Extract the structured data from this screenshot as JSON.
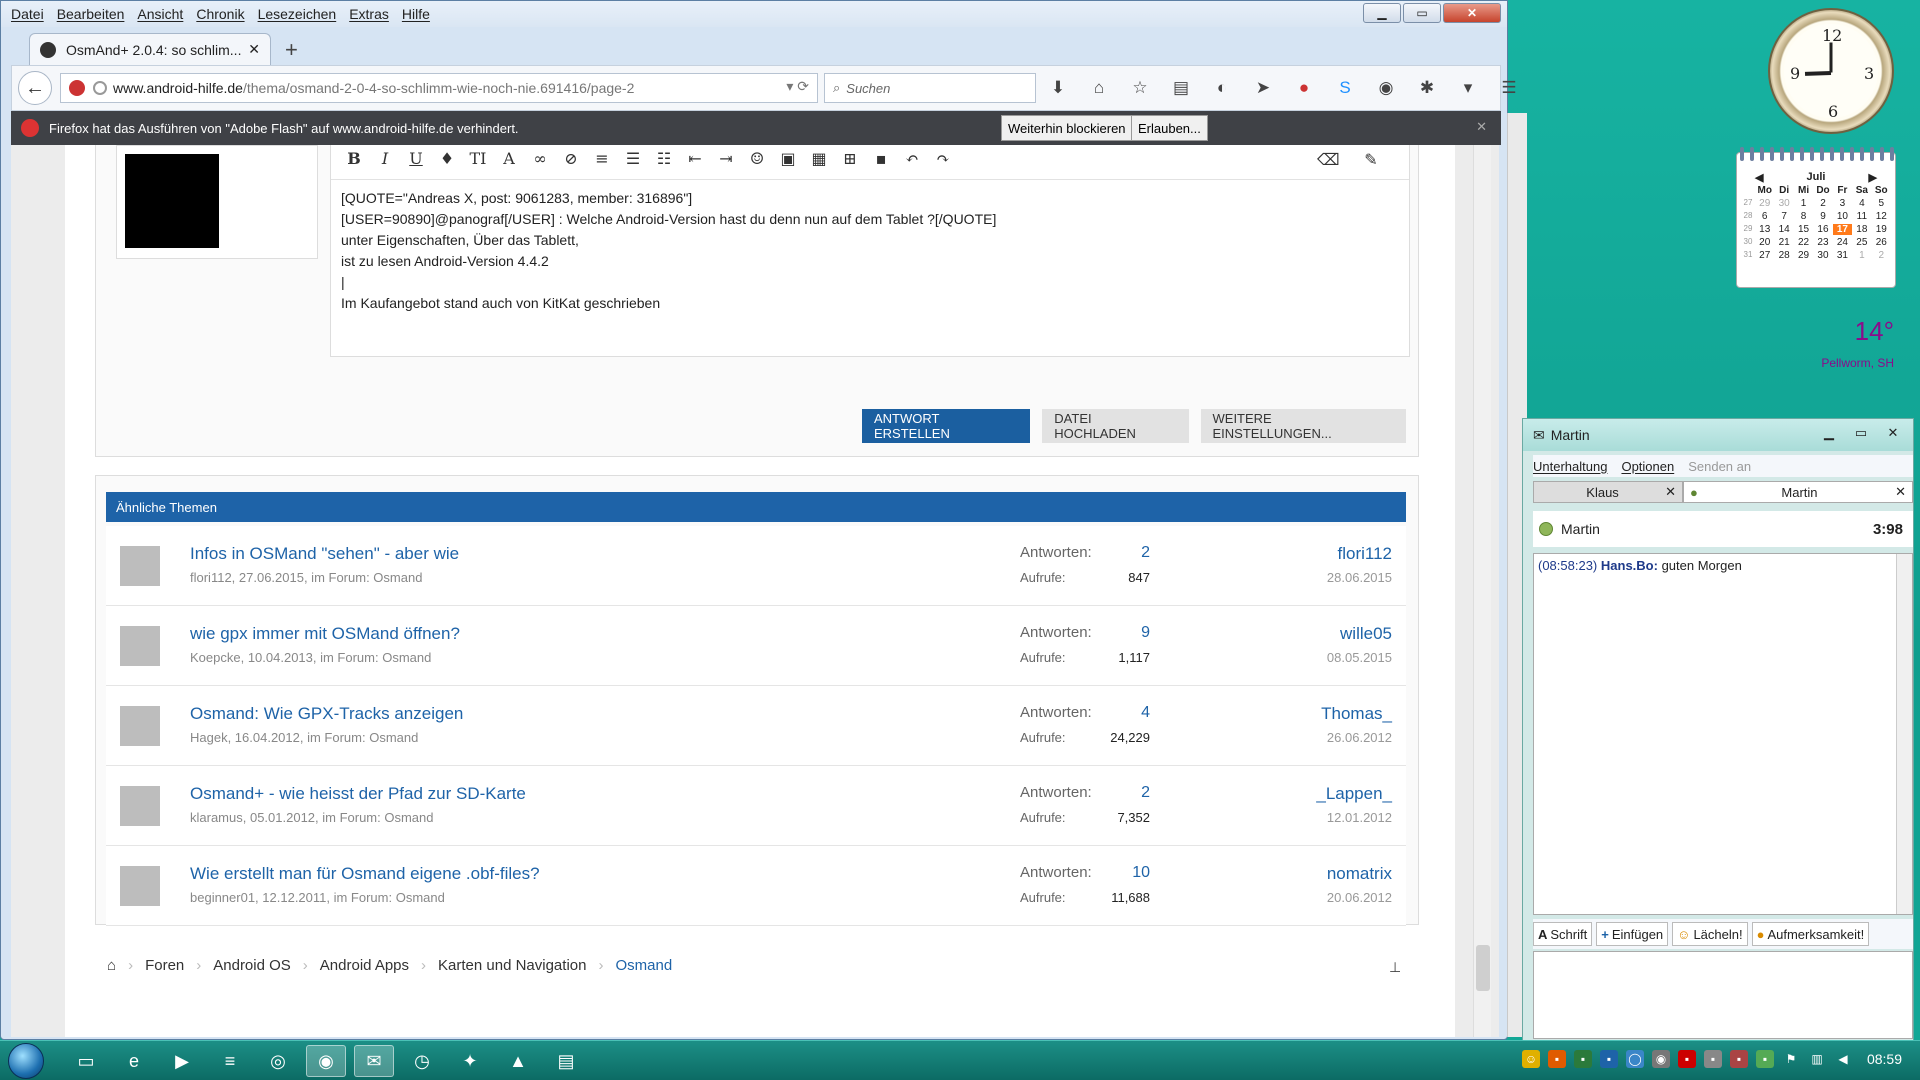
{
  "browser": {
    "menu": [
      "Datei",
      "Bearbeiten",
      "Ansicht",
      "Chronik",
      "Lesezeichen",
      "Extras",
      "Hilfe"
    ],
    "tab_title": "OsmAnd+ 2.0.4: so schlim...",
    "url_host": "www.android-hilfe.de",
    "url_path": "/thema/osmand-2-0-4-so-schlimm-wie-noch-nie.691416/page-2",
    "search_placeholder": "Suchen",
    "flash_message": "Firefox hat das Ausführen von \"Adobe Flash\" auf www.android-hilfe.de verhindert.",
    "flash_block": "Weiterhin blockieren",
    "flash_allow": "Erlauben..."
  },
  "editor": {
    "lines": [
      "[QUOTE=\"Andreas X, post: 9061283, member: 316896\"]",
      "[USER=90890]@panograf[/USER] : Welche Android-Version hast du denn nun auf dem Tablet ?[/QUOTE]",
      "unter Eigenschaften, Über das Tablett,",
      "ist zu lesen Android-Version 4.4.2",
      "|",
      "Im Kaufangebot stand auch von KitKat geschrieben"
    ],
    "btn_reply": "ANTWORT ERSTELLEN",
    "btn_upload": "DATEI HOCHLADEN",
    "btn_more": "WEITERE EINSTELLUNGEN..."
  },
  "similar": {
    "heading": "Ähnliche Themen",
    "label_answers": "Antworten:",
    "label_views": "Aufrufe:",
    "rows": [
      {
        "title": "Infos in OSMand \"sehen\" - aber wie",
        "meta": "flori112, 27.06.2015, im Forum: Osmand",
        "answers": "2",
        "views": "847",
        "user": "flori112",
        "date": "28.06.2015"
      },
      {
        "title": "wie gpx immer mit OSMand öffnen?",
        "meta": "Koepcke, 10.04.2013, im Forum: Osmand",
        "answers": "9",
        "views": "1,117",
        "user": "wille05",
        "date": "08.05.2015"
      },
      {
        "title": "Osmand: Wie GPX-Tracks anzeigen",
        "meta": "Hagek, 16.04.2012, im Forum: Osmand",
        "answers": "4",
        "views": "24,229",
        "user": "Thomas_",
        "date": "26.06.2012"
      },
      {
        "title": "Osmand+ - wie heisst der Pfad zur SD-Karte",
        "meta": "klaramus, 05.01.2012, im Forum: Osmand",
        "answers": "2",
        "views": "7,352",
        "user": "_Lappen_",
        "date": "12.01.2012"
      },
      {
        "title": "Wie erstellt man für Osmand eigene .obf-files?",
        "meta": "beginner01, 12.12.2011, im Forum: Osmand",
        "answers": "10",
        "views": "11,688",
        "user": "nomatrix",
        "date": "20.06.2012"
      }
    ]
  },
  "breadcrumb": [
    "Foren",
    "Android OS",
    "Android Apps",
    "Karten und Navigation",
    "Osmand"
  ],
  "calendar": {
    "month": "Juli",
    "days": [
      "Mo",
      "Di",
      "Mi",
      "Do",
      "Fr",
      "Sa",
      "So"
    ],
    "weeks": [
      {
        "wk": "27",
        "d": [
          "29",
          "30",
          "1",
          "2",
          "3",
          "4",
          "5"
        ]
      },
      {
        "wk": "28",
        "d": [
          "6",
          "7",
          "8",
          "9",
          "10",
          "11",
          "12"
        ]
      },
      {
        "wk": "29",
        "d": [
          "13",
          "14",
          "15",
          "16",
          "17",
          "18",
          "19"
        ]
      },
      {
        "wk": "30",
        "d": [
          "20",
          "21",
          "22",
          "23",
          "24",
          "25",
          "26"
        ]
      },
      {
        "wk": "31",
        "d": [
          "27",
          "28",
          "29",
          "30",
          "31",
          "1",
          "2"
        ]
      }
    ],
    "today": "17"
  },
  "weather": {
    "temp": "14°",
    "location": "Pellworm, SH"
  },
  "chat": {
    "title": "Martin",
    "menu": [
      "Unterhaltung",
      "Optionen"
    ],
    "menu_disabled": "Senden an",
    "tab1": "Klaus",
    "tab2": "Martin",
    "contact": "Martin",
    "count": "3:98",
    "messages": [
      {
        "time": "(08:58:23)",
        "name": "Hans.Bo:",
        "text": " guten Morgen"
      }
    ],
    "tools": [
      "Schrift",
      "Einfügen",
      "Lächeln!",
      "Aufmerksamkeit!"
    ]
  },
  "taskbar": {
    "time": "08:59"
  }
}
